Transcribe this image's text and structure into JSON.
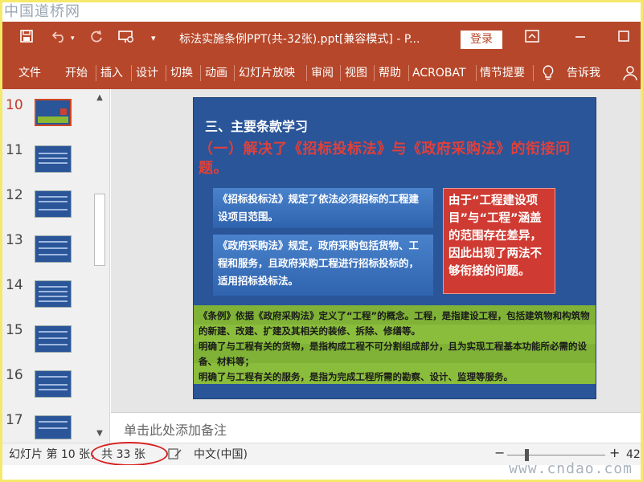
{
  "watermark_top": "中国道桥网",
  "watermark_bottom": "www.cndao.com",
  "titlebar": {
    "save_icon": "save-icon",
    "undo_icon": "undo-icon",
    "redo_icon": "redo-icon",
    "present_icon": "present-from-start-icon",
    "qat_more_icon": "chevron-down-icon",
    "title": "标法实施条例PPT(共-32张).ppt[兼容模式] - P...",
    "login_label": "登录",
    "ribbon_display_icon": "ribbon-display-options-icon",
    "maximize_icon": "maximize-icon"
  },
  "ribbon": {
    "tabs": [
      "文件",
      "开始",
      "插入",
      "设计",
      "切换",
      "动画",
      "幻灯片放映",
      "审阅",
      "视图",
      "帮助",
      "ACROBAT",
      "情节提要"
    ],
    "tell_me_icon": "lightbulb-icon",
    "tell_me_label": "告诉我",
    "user_icon": "person-icon"
  },
  "thumbnails": {
    "numbers": [
      "10",
      "11",
      "12",
      "13",
      "14",
      "15",
      "16",
      "17"
    ],
    "selected": "10"
  },
  "slide": {
    "heading": "三、主要条款学习",
    "subtitle": "（一）解决了《招标投标法》与《政府采购法》的衔接问题。",
    "box1": "《招标投标法》规定了依法必须招标的工程建设项目范围。",
    "box2": "《政府采购法》规定，政府采购包括货物、工程和服务，且政府采购工程进行招标投标的，适用招标投标法。",
    "red_box": "由于“工程建设项目”与“工程”涵盖的范围存在差异，因此出现了两法不够衔接的问题。",
    "green_lines": [
      "《条例》依据《政府采购法》定义了“工程”的概念。工程，是指建设工程，包括建筑物和构筑物的新建、改建、扩建及其相关的装修、拆除、修缮等。",
      "明确了与工程有关的货物，是指构成工程不可分割组成部分，且为实现工程基本功能所必需的设备、材料等；",
      "明确了与工程有关的服务，是指为完成工程所需的勘察、设计、监理等服务。"
    ]
  },
  "notes_placeholder": "单击此处添加备注",
  "status": {
    "slide_of": "幻灯片 第 10 张，共 33 张",
    "notes_icon": "notes-edit-icon",
    "language": "中文(中国)",
    "zoom_minus": "−",
    "zoom_plus": "+",
    "zoom_value": "42"
  },
  "colors": {
    "accent": "#b7472a",
    "slide_bg": "#2a5599",
    "slide_red": "#cf3b32",
    "slide_green": "#8bbd3c",
    "callout": "#d82020"
  }
}
